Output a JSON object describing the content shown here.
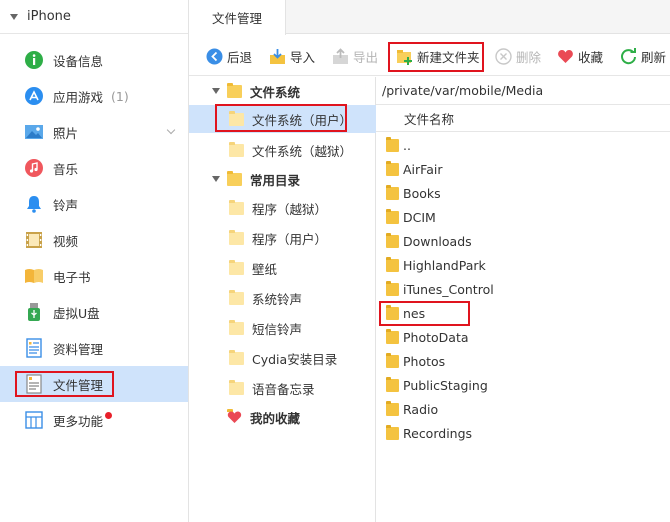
{
  "device": {
    "name": "iPhone"
  },
  "sidebar": {
    "items": [
      {
        "label": "设备信息",
        "count": ""
      },
      {
        "label": "应用游戏",
        "count": "(1)"
      },
      {
        "label": "照片",
        "count": ""
      },
      {
        "label": "音乐",
        "count": ""
      },
      {
        "label": "铃声",
        "count": ""
      },
      {
        "label": "视频",
        "count": ""
      },
      {
        "label": "电子书",
        "count": ""
      },
      {
        "label": "虚拟U盘",
        "count": ""
      },
      {
        "label": "资料管理",
        "count": ""
      },
      {
        "label": "文件管理",
        "count": ""
      },
      {
        "label": "更多功能",
        "count": ""
      }
    ]
  },
  "tabs": {
    "active": "文件管理"
  },
  "toolbar": {
    "back": "后退",
    "import": "导入",
    "export": "导出",
    "new_folder": "新建文件夹",
    "delete": "删除",
    "favorite": "收藏",
    "refresh": "刷新"
  },
  "tree": {
    "file_system": "文件系统",
    "file_system_user": "文件系统（用户）",
    "file_system_jb": "文件系统（越狱）",
    "common_dirs": "常用目录",
    "programs_jb": "程序（越狱）",
    "programs_user": "程序（用户）",
    "wallpaper": "壁纸",
    "system_ringtones": "系统铃声",
    "sms_ringtones": "短信铃声",
    "cydia_dir": "Cydia安装目录",
    "voice_memos": "语音备忘录",
    "my_favorites": "我的收藏"
  },
  "filelist": {
    "path": "/private/var/mobile/Media",
    "column_name": "文件名称",
    "entries": [
      "..",
      "AirFair",
      "Books",
      "DCIM",
      "Downloads",
      "HighlandPark",
      "iTunes_Control",
      "nes",
      "PhotoData",
      "Photos",
      "PublicStaging",
      "Radio",
      "Recordings"
    ]
  },
  "colors": {
    "accent": "#3a8ee6",
    "selection": "#cfe3fb",
    "highlight_box": "#e0141e",
    "folder": "#f8cf5a"
  }
}
